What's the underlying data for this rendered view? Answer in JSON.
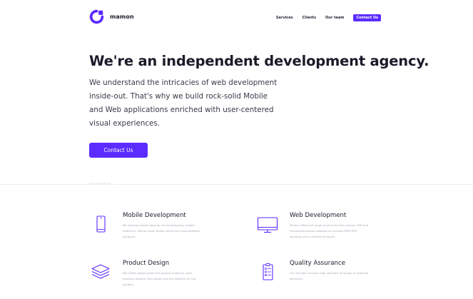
{
  "brand": {
    "name": "mamon",
    "accent_color": "#5b2bff"
  },
  "nav": {
    "items": [
      {
        "label": "Services"
      },
      {
        "label": "Clients"
      },
      {
        "label": "Our team"
      }
    ],
    "cta_label": "Contact Us"
  },
  "hero": {
    "title": "We're an independent development agency.",
    "description": "We understand the intricacies of web development inside-out. That's why we build rock-solid Mobile and Web applications enriched with user-centered visual experiences.",
    "button_label": "Contact Us"
  },
  "services": {
    "section_label": "OUR SERVICES",
    "items": [
      {
        "title": "Mobile Development",
        "description": "We develop mobile apps for all contemporary mobile platforms. Mamon team builds native and cross-platform solutions.",
        "icon": "mobile-phone-icon"
      },
      {
        "title": "Web Development",
        "description": "Mamon offers full range of services from various CMS and frameworks-based websites to complex ERP/CRM solutions and e-commerce stores.",
        "icon": "monitor-icon"
      },
      {
        "title": "Product Design",
        "description": "We create design given the product audience, goal, business domain, technology and the platform for the solution.",
        "icon": "layers-icon"
      },
      {
        "title": "Quality Assurance",
        "description": "Our QA team ensures high standard of quality of products delivered.",
        "icon": "checklist-icon"
      }
    ]
  }
}
